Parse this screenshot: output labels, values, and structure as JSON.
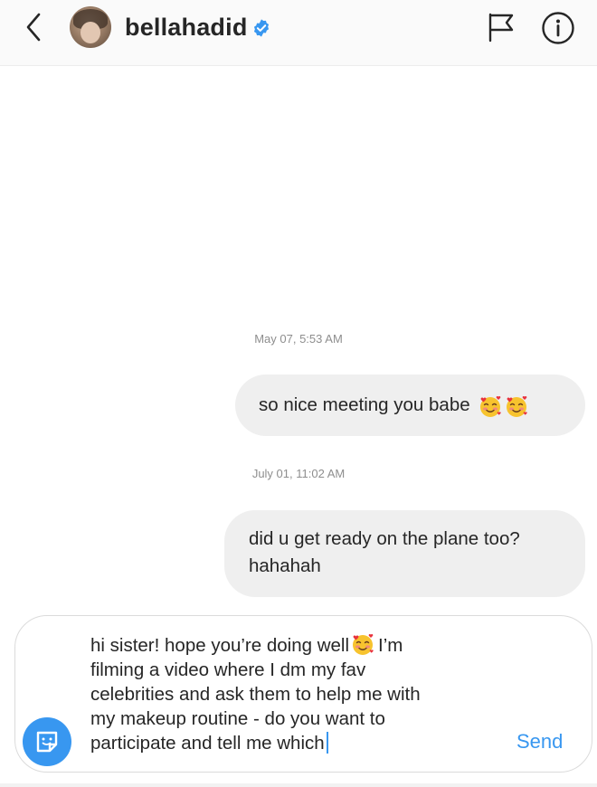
{
  "header": {
    "username": "bellahadid",
    "verified": true
  },
  "messages": [
    {
      "timestamp": "May 07, 5:53 AM",
      "text": "so nice meeting you babe",
      "emoji": [
        "smiling-face-with-hearts",
        "smiling-face-with-hearts"
      ]
    },
    {
      "timestamp": "July 01, 11:02 AM",
      "lines": [
        "did u get ready on the plane too?",
        "hahahah"
      ]
    }
  ],
  "composer": {
    "line1_before_emoji": "hi sister! hope you’re doing well",
    "line1_after_emoji": "I’m",
    "line2": "filming a video where I dm my fav",
    "line3": "celebrities and ask them to help me with",
    "line4": "my makeup routine - do you want to",
    "line5": "participate and tell me which",
    "send_label": "Send"
  },
  "colors": {
    "accent": "#3897f0",
    "bubble": "#efefef",
    "text": "#262626",
    "muted": "#8e8e8e"
  },
  "icons": [
    "back-chevron-icon",
    "verified-badge-icon",
    "flag-icon",
    "info-icon",
    "sticker-icon",
    "smiling-face-with-hearts-emoji"
  ]
}
